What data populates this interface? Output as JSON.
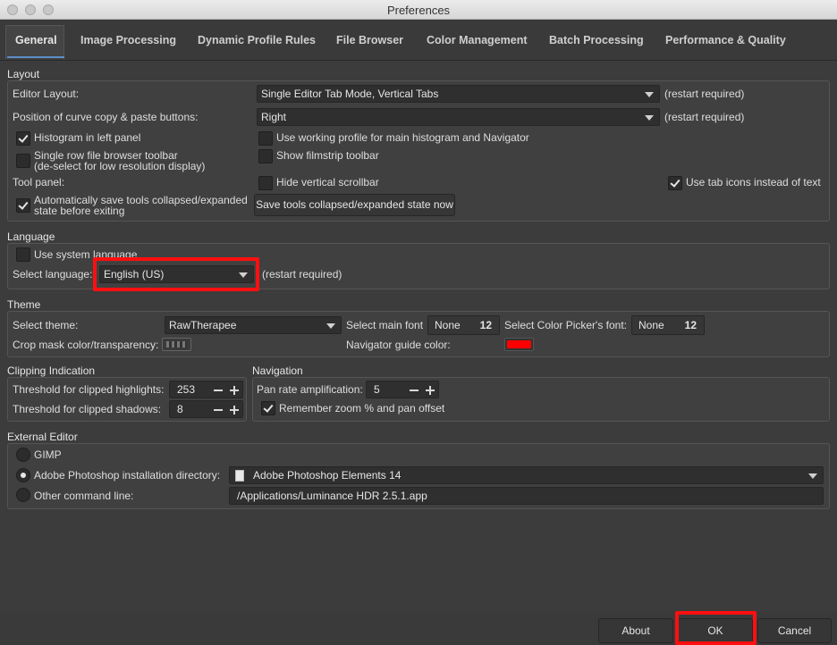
{
  "window": {
    "title": "Preferences"
  },
  "tabs": [
    {
      "label": "General",
      "active": true
    },
    {
      "label": "Image Processing"
    },
    {
      "label": "Dynamic Profile Rules"
    },
    {
      "label": "File Browser"
    },
    {
      "label": "Color Management"
    },
    {
      "label": "Batch Processing"
    },
    {
      "label": "Performance & Quality"
    }
  ],
  "layout": {
    "section_title": "Layout",
    "editor_layout_label": "Editor Layout:",
    "editor_layout_value": "Single Editor Tab Mode, Vertical Tabs",
    "editor_layout_note": "(restart required)",
    "curve_buttons_label": "Position of curve copy & paste buttons:",
    "curve_buttons_value": "Right",
    "curve_buttons_note": "(restart required)",
    "histogram_left": {
      "label": "Histogram in left panel",
      "checked": true
    },
    "working_profile": {
      "label": "Use working profile for main histogram and Navigator",
      "checked": false
    },
    "single_row_line1": "Single row file browser toolbar",
    "single_row_line2": "(de-select for low resolution display)",
    "show_filmstrip": {
      "label": "Show filmstrip toolbar",
      "checked": false
    },
    "tool_panel_label": "Tool panel:",
    "hide_scrollbar": {
      "label": "Hide vertical scrollbar",
      "checked": false
    },
    "tab_icons": {
      "label": "Use tab icons instead of text",
      "checked": true
    },
    "autosave_line1": "Automatically save tools collapsed/expanded",
    "autosave_line2": "state before exiting",
    "save_now_button": "Save tools collapsed/expanded state now"
  },
  "language": {
    "section_title": "Language",
    "use_system": {
      "label": "Use system language",
      "checked": false
    },
    "select_label": "Select language:",
    "select_value": "English (US)",
    "note": "(restart required)"
  },
  "theme": {
    "section_title": "Theme",
    "select_theme_label": "Select theme:",
    "theme_value": "RawTherapee",
    "main_font_label": "Select main font",
    "main_font_name": "None",
    "main_font_size": "12",
    "picker_font_label": "Select Color Picker's font:",
    "picker_font_name": "None",
    "picker_font_size": "12",
    "crop_mask_label": "Crop mask color/transparency:",
    "navigator_guide_label": "Navigator guide color:",
    "navigator_guide_color": "#ff0000"
  },
  "clipping": {
    "section_title": "Clipping Indication",
    "highlights_label": "Threshold for clipped highlights:",
    "highlights_value": "253",
    "shadows_label": "Threshold for clipped shadows:",
    "shadows_value": "8"
  },
  "navigation": {
    "section_title": "Navigation",
    "pan_rate_label": "Pan rate amplification:",
    "pan_rate_value": "5",
    "remember_zoom": {
      "label": "Remember zoom % and pan offset",
      "checked": true
    }
  },
  "external_editor": {
    "section_title": "External Editor",
    "gimp_label": "GIMP",
    "photoshop_label": "Adobe Photoshop installation directory:",
    "photoshop_value": "Adobe Photoshop Elements 14",
    "other_label": "Other command line:",
    "other_value": "/Applications/Luminance HDR 2.5.1.app",
    "selected": "photoshop"
  },
  "buttons": {
    "about": "About",
    "ok": "OK",
    "cancel": "Cancel"
  },
  "colors": {
    "highlight": "#ff0f0f",
    "accent": "#5b8ec7"
  }
}
